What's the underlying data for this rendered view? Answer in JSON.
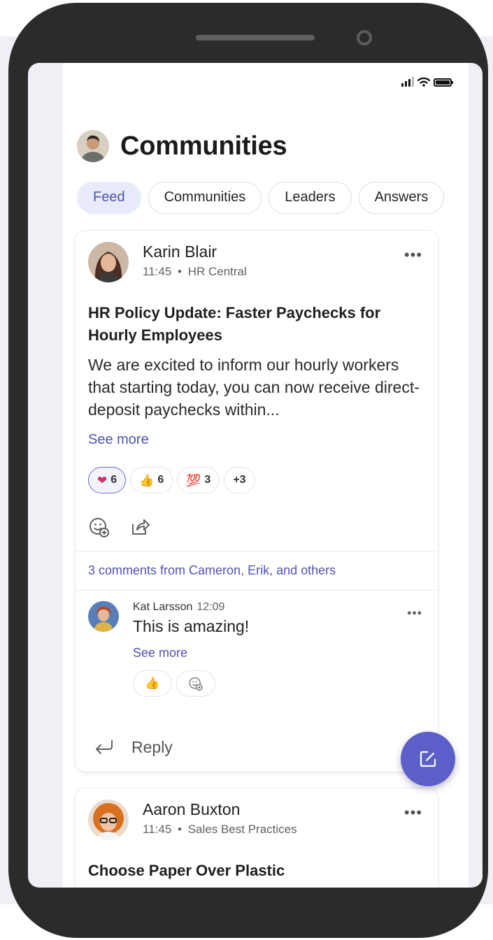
{
  "app": {
    "title": "Communities",
    "tabs": [
      {
        "label": "Feed",
        "active": true
      },
      {
        "label": "Communities",
        "active": false
      },
      {
        "label": "Leaders",
        "active": false
      },
      {
        "label": "Answers",
        "active": false
      }
    ]
  },
  "posts": [
    {
      "author": "Karin Blair",
      "time": "11:45",
      "community": "HR Central",
      "separator": "•",
      "title": "HR Policy Update: Faster Paychecks for Hourly Employees",
      "body": "We are excited to inform our hourly workers that starting today, you can now receive direct-deposit paychecks within...",
      "see_more": "See more",
      "reactions": [
        {
          "icon": "heart-icon",
          "emoji": "❤",
          "count": "6",
          "mine": true
        },
        {
          "icon": "thumbs-up-icon",
          "emoji": "👍",
          "count": "6",
          "mine": false
        },
        {
          "icon": "hundred-points-icon",
          "emoji": "💯",
          "count": "3",
          "mine": false
        },
        {
          "icon": "more-reactions",
          "emoji": "",
          "count": "+3",
          "mine": false
        }
      ],
      "comments_summary": "3 comments from Cameron, Erik, and others",
      "comment": {
        "author": "Kat Larsson",
        "time": "12:09",
        "text": "This is amazing!",
        "see_more": "See more",
        "reaction_emoji": "👍"
      },
      "reply_label": "Reply"
    },
    {
      "author": "Aaron Buxton",
      "time": "11:45",
      "community": "Sales Best Practices",
      "separator": "•",
      "title": "Choose Paper Over Plastic"
    }
  ],
  "colors": {
    "accent": "#5b5fc7",
    "link": "#4f52b2",
    "tab_active_bg": "#e8ebfa",
    "phone_frame": "#2b2b2b"
  }
}
